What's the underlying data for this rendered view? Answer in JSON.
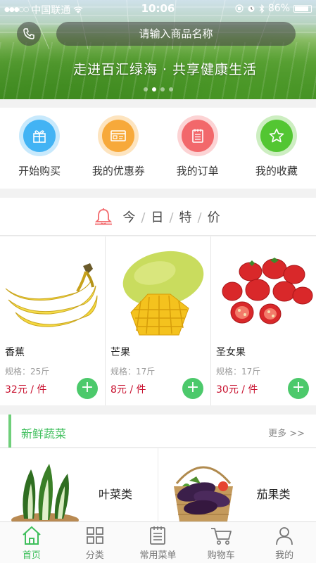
{
  "status_bar": {
    "carrier": "中国联通",
    "time": "10:06",
    "battery": "86%"
  },
  "search": {
    "placeholder": "请输入商品名称"
  },
  "banner": {
    "slogan": "走进百汇绿海 · 共享健康生活",
    "slides": 4,
    "active_slide": 2
  },
  "quick_nav": [
    {
      "label": "开始购买",
      "icon": "gift-icon",
      "color": "#42b3f4",
      "ring": "#c8e9fc"
    },
    {
      "label": "我的优惠券",
      "icon": "coupon-icon",
      "color": "#f7a93a",
      "ring": "#fde4bf"
    },
    {
      "label": "我的订单",
      "icon": "order-list-icon",
      "color": "#f2686b",
      "ring": "#fcd3d4"
    },
    {
      "label": "我的收藏",
      "icon": "star-icon",
      "color": "#53c632",
      "ring": "#cdeec1"
    }
  ],
  "today": {
    "chars": [
      "今",
      "日",
      "特",
      "价"
    ],
    "separator": "/",
    "icon": "bell-icon",
    "products": [
      {
        "name": "香蕉",
        "spec": "规格：25斤",
        "price": "32元 / 件"
      },
      {
        "name": "芒果",
        "spec": "规格：17斤",
        "price": "8元 / 件"
      },
      {
        "name": "圣女果",
        "spec": "规格：17斤",
        "price": "30元 / 件"
      }
    ]
  },
  "fresh_veg": {
    "title": "新鲜蔬菜",
    "more": "更多 >>",
    "items": [
      {
        "label": "叶菜类"
      },
      {
        "label": "茄果类"
      }
    ]
  },
  "tabs": [
    {
      "label": "首页",
      "icon": "home-icon",
      "active": true
    },
    {
      "label": "分类",
      "icon": "grid-icon",
      "active": false
    },
    {
      "label": "常用菜单",
      "icon": "menu-list-icon",
      "active": false
    },
    {
      "label": "购物车",
      "icon": "cart-icon",
      "active": false
    },
    {
      "label": "我的",
      "icon": "user-icon",
      "active": false
    }
  ],
  "colors": {
    "accent": "#3fbf5c",
    "price": "#c8102e",
    "add_button": "#4cc96b"
  }
}
